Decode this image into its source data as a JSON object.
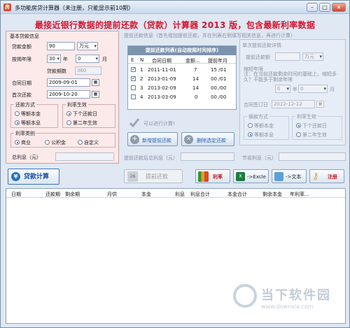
{
  "window": {
    "title": "多功能房贷计算器（未注册，只能显示前10期）",
    "banner": "最接近银行数据的提前还款（贷款）计算器 2013 版，包含最新利率数据",
    "app_icon": "房"
  },
  "basic": {
    "group": "基本贷款信息",
    "amount_label": "贷款金额",
    "amount_value": "90",
    "amount_unit": "万元",
    "years_label": "按揭年限",
    "years_value": "30",
    "years_unit": "年",
    "months_value": "0",
    "months_unit": "月",
    "periods_label": "贷款期数",
    "periods_value": "360",
    "contract_label": "合同日期",
    "contract_value": "2009-09-01",
    "first_pay_label": "首次还款",
    "first_pay_value": "2009-10-20",
    "method_group": "还款方式",
    "method_opt1": "等额本金",
    "method_opt2": "等额本息",
    "effect_group": "利率生效",
    "effect_opt1": "下个还款日",
    "effect_opt2": "第二年生效",
    "type_group": "利率类别",
    "type_opt1": "商业",
    "type_opt2": "公积金",
    "type_opt3": "自定义",
    "total_interest_label": "总利息（元）"
  },
  "prepay": {
    "group": "提前还款信息（首先增加提前还款，并在列表右侧填写相关信息，再进行计算）",
    "list_title": "提前还款列表(自动按照时间排序)",
    "cols": [
      "E",
      "N",
      "合同日期",
      "金额...",
      "提前年月"
    ],
    "rows": [
      {
        "checked": "✓",
        "n": "1",
        "date": "2011-11-01",
        "amount": "7",
        "ym": "15 /01"
      },
      {
        "checked": "✓",
        "n": "2",
        "date": "2013-01-09",
        "amount": "14",
        "ym": "00 /01"
      },
      {
        "checked": "",
        "n": "3",
        "date": "2013-02-09",
        "amount": "14",
        "ym": "00 /00"
      },
      {
        "checked": "",
        "n": "4",
        "date": "2013-03-09",
        "amount": "0",
        "ym": "00 /00"
      }
    ],
    "can_calc": "可以进行计算!",
    "add_btn": "新增提前还款",
    "del_btn": "删除选定还款",
    "after_interest_label": "提前还款后总利息（元）",
    "saved_interest_label": "节省利息（元）"
  },
  "detail": {
    "group": "单次提前还款详情",
    "amount_label": "提前还款额",
    "amount_unit": "万元",
    "shorten_label": "缩短年限",
    "shorten_note": "注：在当前还款剩余时间的基础上，缩短多久？不能多于剩余年限",
    "years_value": "0",
    "years_unit": "年",
    "months_value": "0",
    "months_unit": "月",
    "adjust_label": "合同签订日",
    "adjust_value": "2012-12-12",
    "method_group": "换款方式",
    "method_opt1": "等额本金",
    "method_opt2": "等额本息",
    "effect_group": "利率生效",
    "effect_opt1": "下个还款日",
    "effect_opt2": "第二年生效"
  },
  "toolbar": {
    "loan_calc": "贷款计算",
    "prepay_calc": "提前还款",
    "calendar_num": "26",
    "rate": "利率",
    "excel": "->Excle",
    "text": "->文本",
    "register": "注册"
  },
  "grid": {
    "cols": [
      "日期",
      "还款期",
      "剩余期",
      "月供",
      "本金",
      "利息",
      "利息合计",
      "本金合计",
      "剩余本金",
      "年利率..."
    ]
  },
  "watermark": {
    "title": "当下软件园",
    "url": "www.downxia.com"
  }
}
